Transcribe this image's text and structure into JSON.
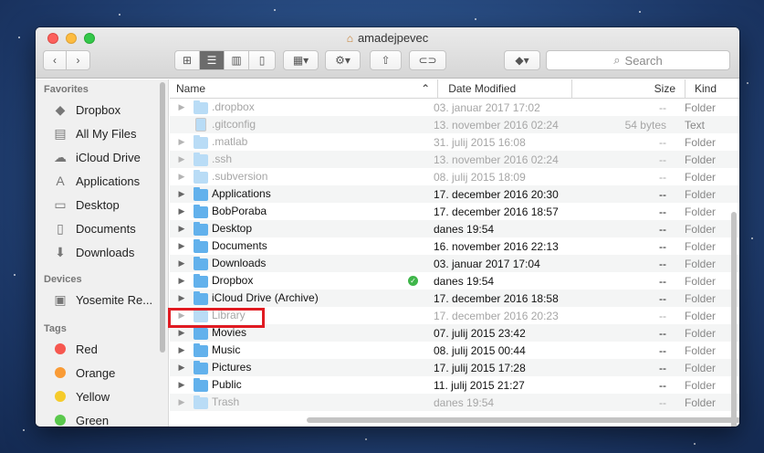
{
  "window": {
    "title": "amadejpevec"
  },
  "toolbar": {
    "search_placeholder": "Search"
  },
  "sidebar": {
    "favorites_label": "Favorites",
    "favorites": [
      {
        "label": "Dropbox",
        "icon": "dropbox-icon"
      },
      {
        "label": "All My Files",
        "icon": "all-files-icon"
      },
      {
        "label": "iCloud Drive",
        "icon": "cloud-icon"
      },
      {
        "label": "Applications",
        "icon": "applications-icon"
      },
      {
        "label": "Desktop",
        "icon": "desktop-icon"
      },
      {
        "label": "Documents",
        "icon": "documents-icon"
      },
      {
        "label": "Downloads",
        "icon": "downloads-icon"
      }
    ],
    "devices_label": "Devices",
    "devices": [
      {
        "label": "Yosemite Re...",
        "icon": "disk-icon"
      }
    ],
    "tags_label": "Tags",
    "tags": [
      {
        "label": "Red",
        "color": "#f6574f"
      },
      {
        "label": "Orange",
        "color": "#f99b36"
      },
      {
        "label": "Yellow",
        "color": "#f5cb2b"
      },
      {
        "label": "Green",
        "color": "#5ac84c"
      }
    ]
  },
  "columns": {
    "name": "Name",
    "date": "Date Modified",
    "size": "Size",
    "kind": "Kind"
  },
  "files": [
    {
      "name": ".dropbox",
      "date": "03. januar 2017 17:02",
      "size": "--",
      "kind": "Folder",
      "folder": true,
      "dim": true
    },
    {
      "name": ".gitconfig",
      "date": "13. november 2016 02:24",
      "size": "54 bytes",
      "kind": "Text",
      "folder": false,
      "dim": true
    },
    {
      "name": ".matlab",
      "date": "31. julij 2015 16:08",
      "size": "--",
      "kind": "Folder",
      "folder": true,
      "dim": true
    },
    {
      "name": ".ssh",
      "date": "13. november 2016 02:24",
      "size": "--",
      "kind": "Folder",
      "folder": true,
      "dim": true
    },
    {
      "name": ".subversion",
      "date": "08. julij 2015 18:09",
      "size": "--",
      "kind": "Folder",
      "folder": true,
      "dim": true
    },
    {
      "name": "Applications",
      "date": "17. december 2016 20:30",
      "size": "--",
      "kind": "Folder",
      "folder": true,
      "dim": false
    },
    {
      "name": "BobPoraba",
      "date": "17. december 2016 18:57",
      "size": "--",
      "kind": "Folder",
      "folder": true,
      "dim": false
    },
    {
      "name": "Desktop",
      "date": "danes 19:54",
      "size": "--",
      "kind": "Folder",
      "folder": true,
      "dim": false
    },
    {
      "name": "Documents",
      "date": "16. november 2016 22:13",
      "size": "--",
      "kind": "Folder",
      "folder": true,
      "dim": false
    },
    {
      "name": "Downloads",
      "date": "03. januar 2017 17:04",
      "size": "--",
      "kind": "Folder",
      "folder": true,
      "dim": false
    },
    {
      "name": "Dropbox",
      "date": "danes 19:54",
      "size": "--",
      "kind": "Folder",
      "folder": true,
      "dim": false,
      "synced": true
    },
    {
      "name": "iCloud Drive (Archive)",
      "date": "17. december 2016 18:58",
      "size": "--",
      "kind": "Folder",
      "folder": true,
      "dim": false
    },
    {
      "name": "Library",
      "date": "17. december 2016 20:23",
      "size": "--",
      "kind": "Folder",
      "folder": true,
      "dim": true
    },
    {
      "name": "Movies",
      "date": "07. julij 2015 23:42",
      "size": "--",
      "kind": "Folder",
      "folder": true,
      "dim": false
    },
    {
      "name": "Music",
      "date": "08. julij 2015 00:44",
      "size": "--",
      "kind": "Folder",
      "folder": true,
      "dim": false
    },
    {
      "name": "Pictures",
      "date": "17. julij 2015 17:28",
      "size": "--",
      "kind": "Folder",
      "folder": true,
      "dim": false
    },
    {
      "name": "Public",
      "date": "11. julij 2015 21:27",
      "size": "--",
      "kind": "Folder",
      "folder": true,
      "dim": false
    },
    {
      "name": "Trash",
      "date": "danes 19:54",
      "size": "--",
      "kind": "Folder",
      "folder": true,
      "dim": true
    }
  ]
}
